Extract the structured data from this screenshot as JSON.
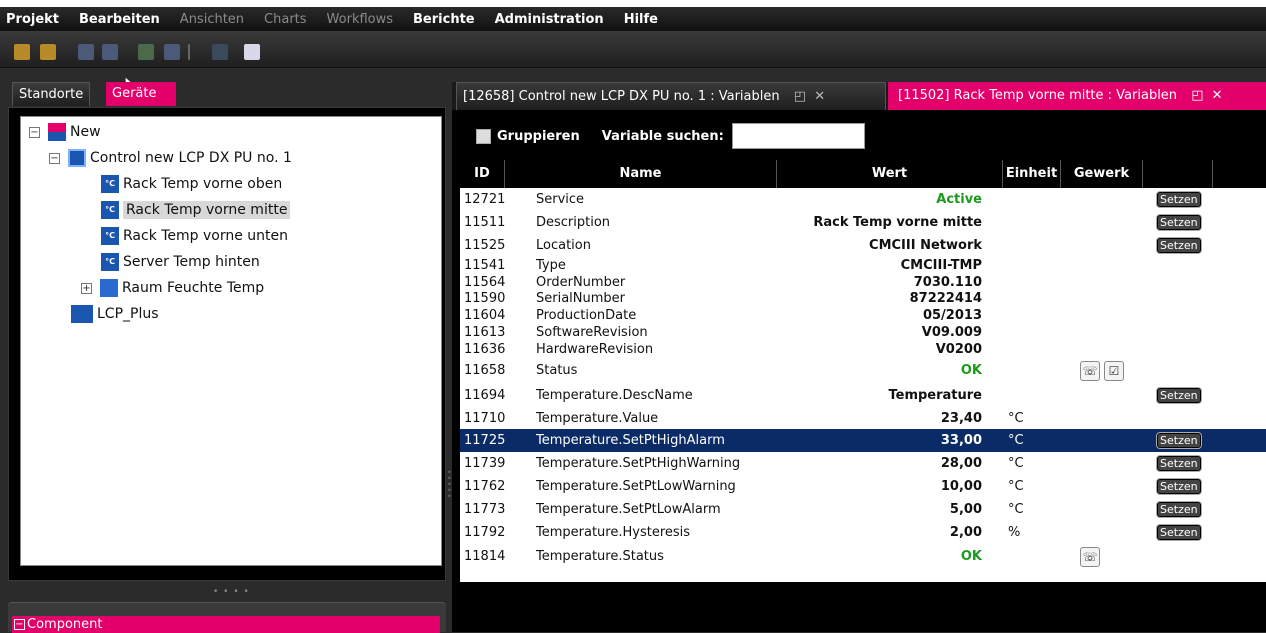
{
  "menu": [
    {
      "label": "Projekt",
      "enabled": true
    },
    {
      "label": "Bearbeiten",
      "enabled": true
    },
    {
      "label": "Ansichten",
      "enabled": false
    },
    {
      "label": "Charts",
      "enabled": false
    },
    {
      "label": "Workflows",
      "enabled": false
    },
    {
      "label": "Berichte",
      "enabled": true
    },
    {
      "label": "Administration",
      "enabled": true
    },
    {
      "label": "Hilfe",
      "enabled": true
    }
  ],
  "left": {
    "tabs": [
      "Standorte",
      "Geräte"
    ],
    "tree": [
      {
        "label": "New",
        "icon": "project-icon",
        "expander": "−"
      },
      {
        "label": "Control new LCP DX PU no. 1",
        "icon": "device-icon",
        "expander": "−"
      },
      {
        "label": "Rack Temp vorne oben",
        "icon": "temperature-sensor-icon",
        "icon_text": "°C"
      },
      {
        "label": "Rack Temp vorne mitte",
        "icon": "temperature-sensor-icon",
        "icon_text": "°C"
      },
      {
        "label": "Rack Temp vorne unten",
        "icon": "temperature-sensor-icon",
        "icon_text": "°C"
      },
      {
        "label": "Server Temp hinten",
        "icon": "temperature-sensor-icon",
        "icon_text": "°C"
      },
      {
        "label": "Raum Feuchte Temp",
        "icon": "humidity-sensor-icon",
        "expander": "+"
      },
      {
        "label": "LCP_Plus",
        "icon": "lcp-device-icon"
      }
    ],
    "component_panel": {
      "expander": "−",
      "label": "Component"
    }
  },
  "right": {
    "tabs": [
      {
        "label": "[12658] Control new LCP DX PU no. 1 : Variablen"
      },
      {
        "label": "[11502] Rack Temp vorne mitte : Variablen"
      }
    ],
    "filter": {
      "group_label": "Gruppieren",
      "search_label": "Variable suchen:",
      "search_value": ""
    },
    "columns": [
      "ID",
      "Name",
      "Wert",
      "Einheit",
      "Gewerk"
    ],
    "set_label": "Setzen",
    "rows": [
      {
        "id": "12721",
        "name": "Service",
        "value": "Active",
        "unit": "",
        "green": true,
        "setzen": true
      },
      {
        "id": "11511",
        "name": "Description",
        "value": "Rack Temp vorne mitte",
        "unit": "",
        "setzen": true
      },
      {
        "id": "11525",
        "name": "Location",
        "value": "CMCIII Network",
        "unit": "",
        "setzen": true
      },
      {
        "id": "11541",
        "name": "Type",
        "value": "CMCIII-TMP",
        "unit": ""
      },
      {
        "id": "11564",
        "name": "OrderNumber",
        "value": "7030.110",
        "unit": ""
      },
      {
        "id": "11590",
        "name": "SerialNumber",
        "value": "87222414",
        "unit": ""
      },
      {
        "id": "11604",
        "name": "ProductionDate",
        "value": "05/2013",
        "unit": ""
      },
      {
        "id": "11613",
        "name": "SoftwareRevision",
        "value": "V09.009",
        "unit": ""
      },
      {
        "id": "11636",
        "name": "HardwareRevision",
        "value": "V0200",
        "unit": ""
      },
      {
        "id": "11658",
        "name": "Status",
        "value": "OK",
        "unit": "",
        "green": true,
        "icons": true
      },
      {
        "id": "11694",
        "name": "Temperature.DescName",
        "value": "Temperature",
        "unit": "",
        "setzen": true
      },
      {
        "id": "11710",
        "name": "Temperature.Value",
        "value": "23,40",
        "unit": "°C"
      },
      {
        "id": "11725",
        "name": "Temperature.SetPtHighAlarm",
        "value": "33,00",
        "unit": "°C",
        "setzen": true,
        "selected": true
      },
      {
        "id": "11739",
        "name": "Temperature.SetPtHighWarning",
        "value": "28,00",
        "unit": "°C",
        "setzen": true
      },
      {
        "id": "11762",
        "name": "Temperature.SetPtLowWarning",
        "value": "10,00",
        "unit": "°C",
        "setzen": true
      },
      {
        "id": "11773",
        "name": "Temperature.SetPtLowAlarm",
        "value": "5,00",
        "unit": "°C",
        "setzen": true
      },
      {
        "id": "11792",
        "name": "Temperature.Hysteresis",
        "value": "2,00",
        "unit": "%",
        "setzen": true
      },
      {
        "id": "11814",
        "name": "Temperature.Status",
        "value": "OK",
        "unit": "",
        "green": true,
        "icon_single": true
      }
    ]
  },
  "colors": {
    "accent": "#e4006a",
    "selected_row": "#0a2b66",
    "ok_green": "#1c9a1c"
  }
}
